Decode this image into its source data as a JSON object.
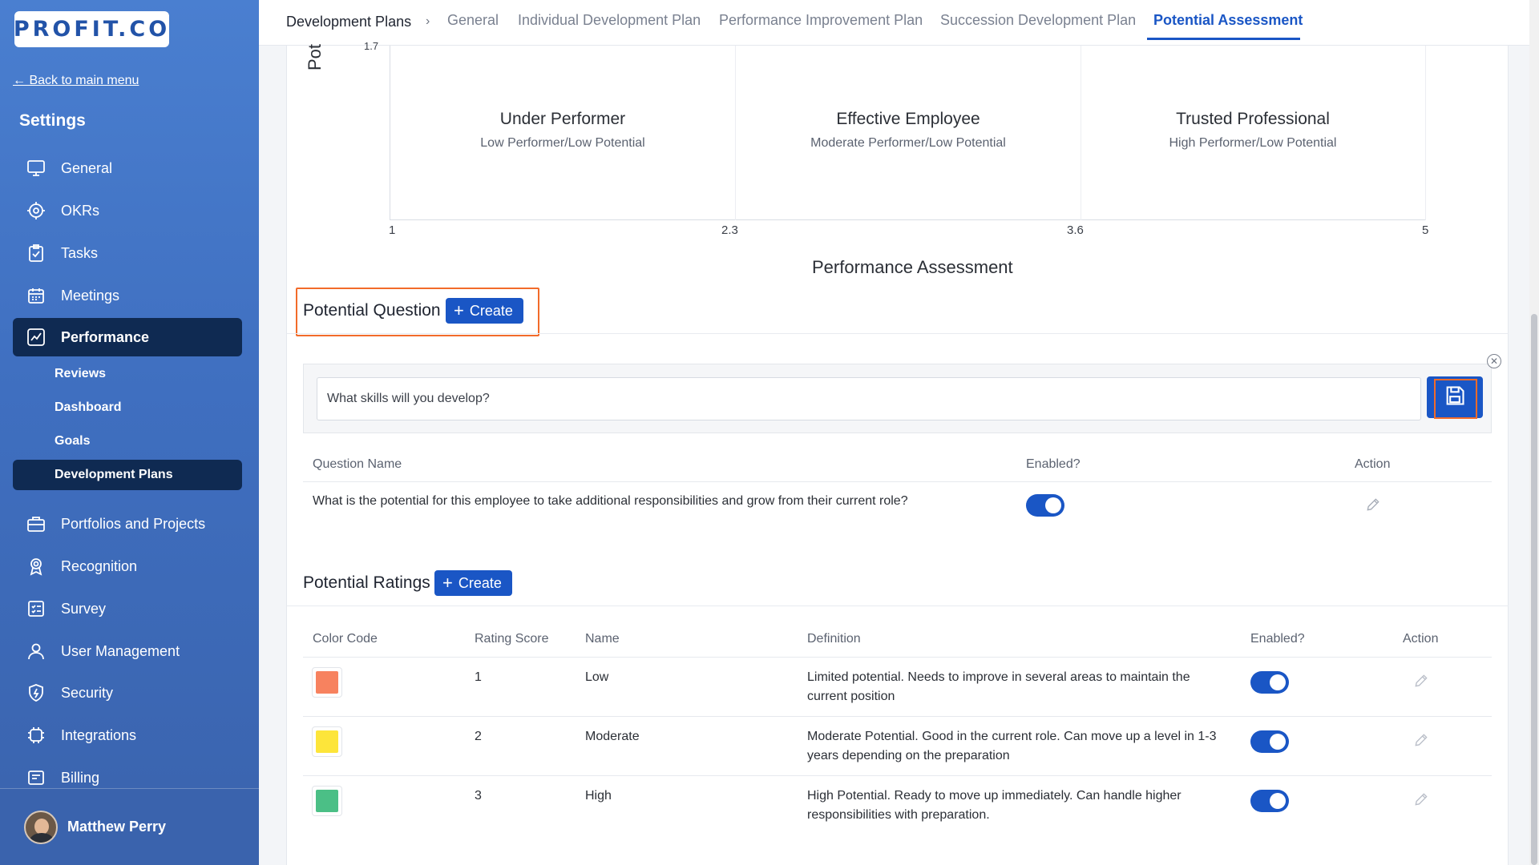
{
  "sidebar": {
    "logo_text": "PROFIT.CO",
    "back_link": "← Back to main menu",
    "settings_title": "Settings",
    "items": [
      {
        "label": "General",
        "icon": "monitor-icon"
      },
      {
        "label": "OKRs",
        "icon": "target-icon"
      },
      {
        "label": "Tasks",
        "icon": "clipboard-check-icon"
      },
      {
        "label": "Meetings",
        "icon": "calendar-icon"
      },
      {
        "label": "Performance",
        "icon": "trend-chart-icon"
      }
    ],
    "sub_items": [
      "Reviews",
      "Dashboard",
      "Goals",
      "Development Plans"
    ],
    "items2": [
      {
        "label": "Portfolios and Projects",
        "icon": "briefcase-icon"
      },
      {
        "label": "Recognition",
        "icon": "award-icon"
      },
      {
        "label": "Survey",
        "icon": "checklist-icon"
      },
      {
        "label": "User Management",
        "icon": "user-icon"
      },
      {
        "label": "Security",
        "icon": "shield-icon"
      },
      {
        "label": "Integrations",
        "icon": "chip-icon"
      },
      {
        "label": "Billing",
        "icon": "receipt-icon"
      }
    ],
    "user_name": "Matthew Perry"
  },
  "topnav": {
    "breadcrumb": "Development Plans",
    "separator": "›",
    "tabs": [
      "General",
      "Individual Development Plan",
      "Performance Improvement Plan",
      "Succession Development Plan",
      "Potential Assessment"
    ],
    "active_tab": "Potential Assessment"
  },
  "grid": {
    "y_axis_label": "Pot",
    "y_tick_top": "1.7",
    "x_axis_label": "Performance Assessment",
    "x_ticks": [
      "1",
      "2.3",
      "3.6",
      "5"
    ],
    "quadrants": [
      {
        "title": "Under Performer",
        "subtitle": "Low Performer/Low Potential"
      },
      {
        "title": "Effective Employee",
        "subtitle": "Moderate Performer/Low Potential"
      },
      {
        "title": "Trusted Professional",
        "subtitle": "High Performer/Low Potential"
      }
    ]
  },
  "potential_question": {
    "title": "Potential Question",
    "create_label": "Create",
    "input_value": "What skills will you develop?",
    "columns": [
      "Question Name",
      "Enabled?",
      "Action"
    ],
    "rows": [
      {
        "question": "What is the potential for this employee to take additional responsibilities and grow from their current role?",
        "enabled": true
      }
    ]
  },
  "potential_ratings": {
    "title": "Potential Ratings",
    "create_label": "Create",
    "columns": [
      "Color Code",
      "Rating Score",
      "Name",
      "Definition",
      "Enabled?",
      "Action"
    ],
    "rows": [
      {
        "color": "#f7825f",
        "score": "1",
        "name": "Low",
        "definition_l1": "Limited potential. Needs to improve in several areas to maintain the",
        "definition_l2": "current position",
        "enabled": true
      },
      {
        "color": "#fde53a",
        "score": "2",
        "name": "Moderate",
        "definition_l1": "Moderate Potential. Good in the current role. Can move up a level in 1-3",
        "definition_l2": "years depending on the preparation",
        "enabled": true
      },
      {
        "color": "#4bbf86",
        "score": "3",
        "name": "High",
        "definition_l1": "High Potential. Ready to move up immediately. Can handle higher",
        "definition_l2": "responsibilities with preparation.",
        "enabled": true
      }
    ]
  },
  "colors": {
    "accent": "#1a56c5",
    "highlight": "#f26b2a",
    "sidebar_active": "#0f2a52"
  }
}
